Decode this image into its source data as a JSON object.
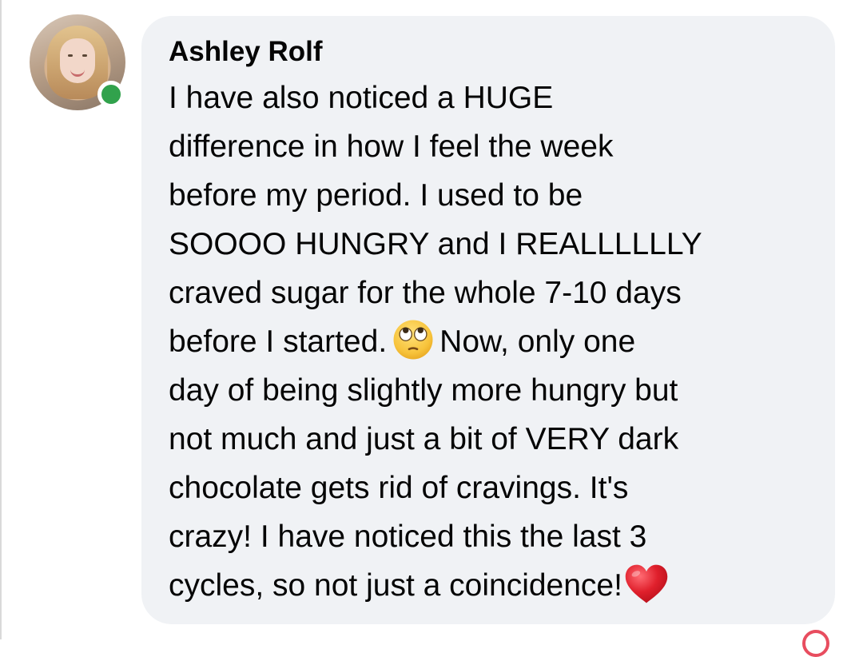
{
  "comment": {
    "author": "Ashley Rolf",
    "lines_before_emoji": "I have also noticed a HUGE\ndifference in how I feel the week\nbefore my period. I used to be\nSOOOO HUNGRY and I REALLLLLLY\ncraved sugar for the whole 7-10 days\nbefore I started.",
    "lines_after_emoji": "Now, only one\nday of being slightly more hungry but\nnot much and just a bit of VERY dark\nchocolate gets rid of cravings. It's\ncrazy! I have noticed this the last 3\ncycles, so not just a coincidence!",
    "emojis": [
      "face-with-rolling-eyes",
      "red-heart"
    ]
  },
  "avatar": {
    "online_status": "online",
    "status_color": "#31a24c"
  },
  "colors": {
    "bubble_background": "#f0f2f5",
    "text": "#050505",
    "heart": "#e0202c"
  }
}
